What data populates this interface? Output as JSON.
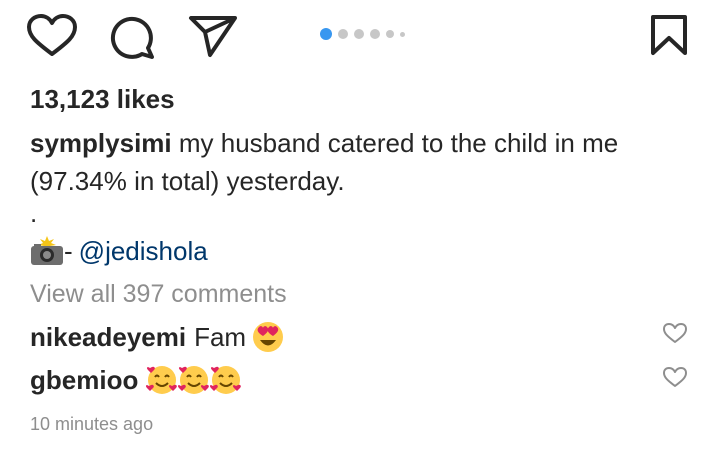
{
  "post": {
    "likes": "13,123 likes",
    "caption_user": "symplysimi",
    "caption_text": "my husband catered to the child in me (97.34% in total) yesterday.",
    "caption_dot": ".",
    "credit_sep": "-",
    "credit_handle": "@jedishola",
    "view_all": "View all 397 comments",
    "timestamp": "10 minutes ago",
    "carousel": {
      "total": 6,
      "active_index": 0
    }
  },
  "comments": [
    {
      "user": "nikeadeyemi",
      "text": "Fam",
      "emojis": [
        "heart-eyes-emoji"
      ]
    },
    {
      "user": "gbemioo",
      "text": "",
      "emojis": [
        "smiling-face-with-hearts-emoji",
        "smiling-face-with-hearts-emoji",
        "smiling-face-with-hearts-emoji"
      ]
    }
  ],
  "icons": {
    "like": "heart-icon",
    "comment": "comment-icon",
    "share": "send-icon",
    "save": "bookmark-icon",
    "credit": "camera-flash-icon",
    "comment_like": "heart-icon"
  },
  "colors": {
    "text": "#262626",
    "muted": "#8e8e8e",
    "link": "#00376b",
    "accent": "#3897f0"
  }
}
